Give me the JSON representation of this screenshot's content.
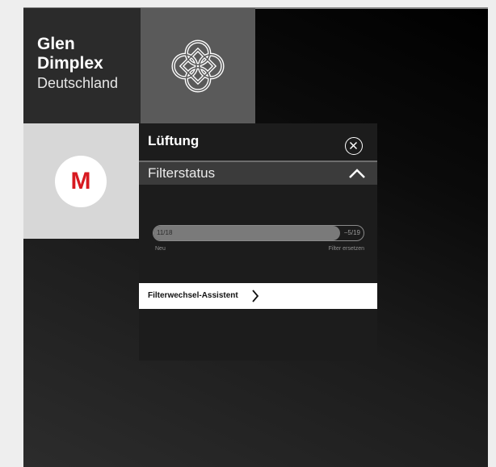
{
  "tiles": {
    "brand": {
      "line1": "Glen",
      "line2": "Dimplex",
      "line3": "Deutschland"
    },
    "knot": {
      "icon": "celtic-knot-icon"
    },
    "miele": {
      "letter": "M",
      "color": "#d71920"
    }
  },
  "panel": {
    "title": "Lüftung",
    "close_icon": "close-circle-icon",
    "section": {
      "label": "Filterstatus",
      "toggle_icon": "chevron-up-icon"
    },
    "filter_progress": {
      "left_label": "11/18",
      "right_label": "−5/19",
      "fill_fraction": 0.89
    },
    "scale": {
      "start": "Neu",
      "end": "Filter ersetzen"
    },
    "assistant": {
      "label": "Filterwechsel-Assistent",
      "icon": "chevron-right-icon"
    }
  }
}
